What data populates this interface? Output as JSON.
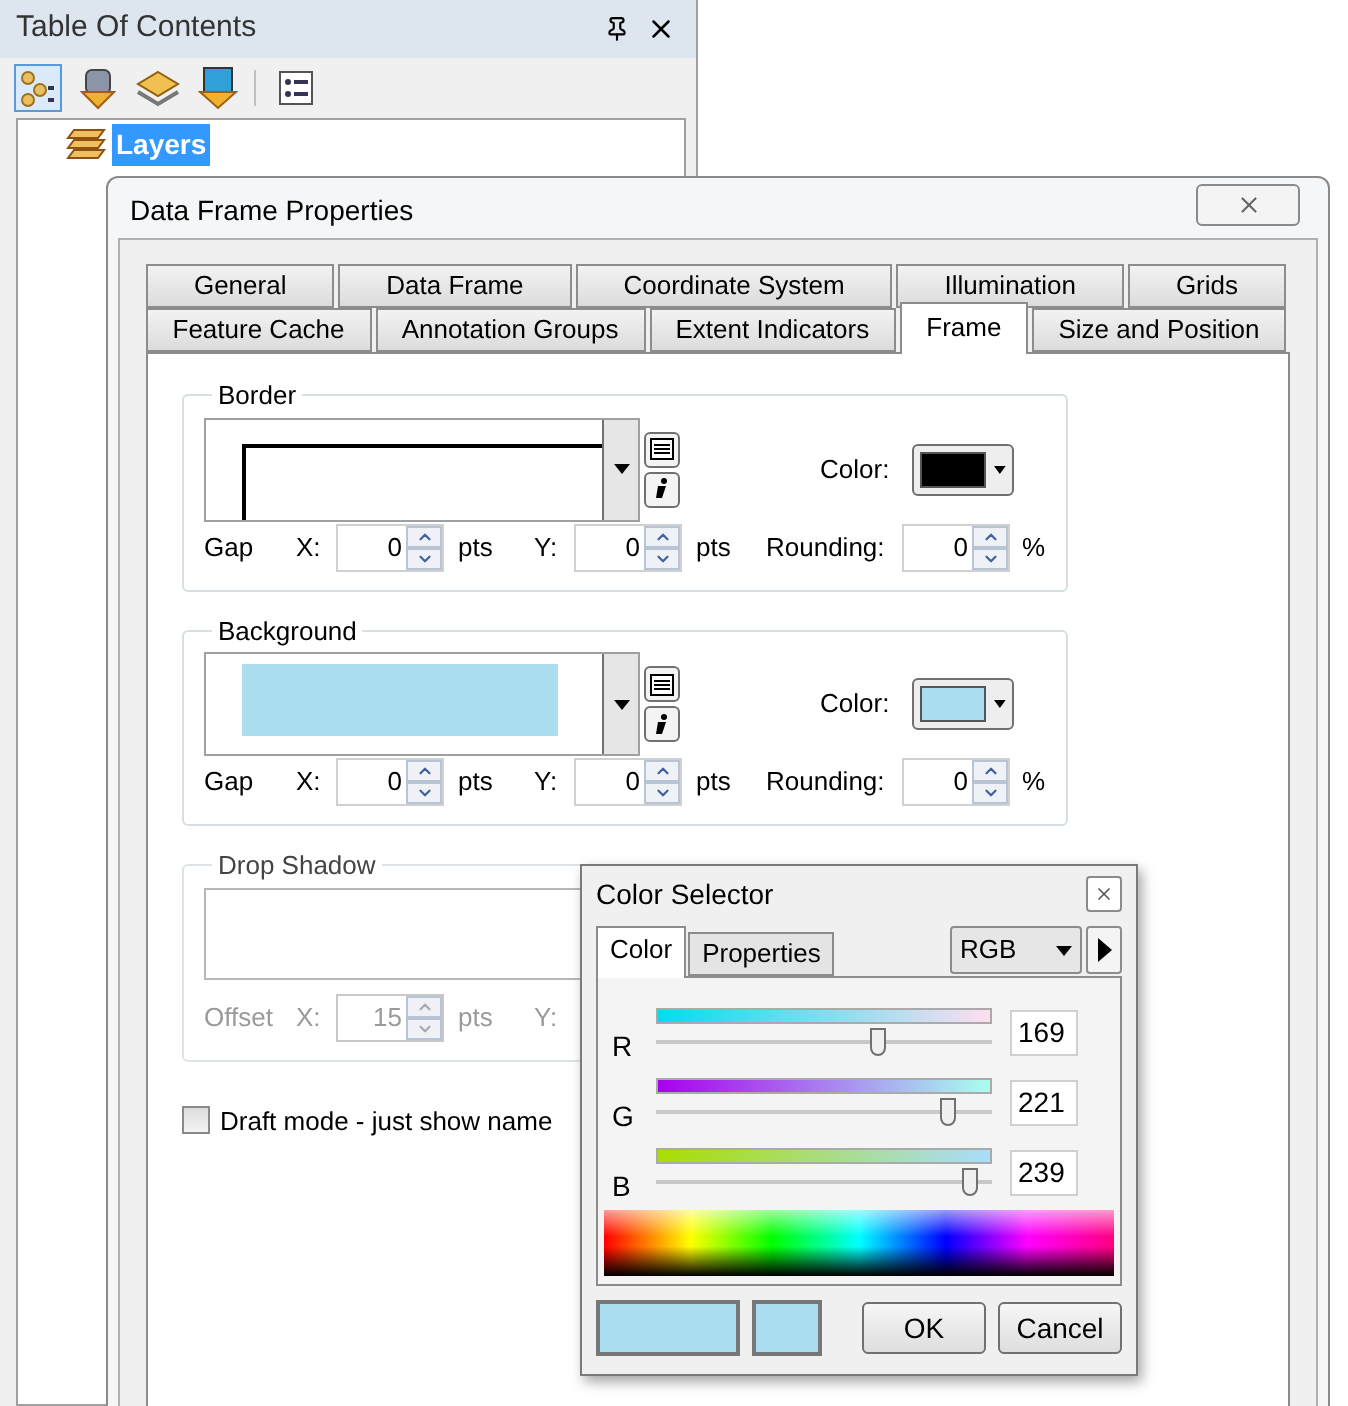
{
  "toc": {
    "title": "Table Of Contents",
    "toolbar": [
      {
        "kind": "drawing_order",
        "selected": true
      },
      {
        "kind": "source",
        "selected": false
      },
      {
        "kind": "visibility",
        "selected": false
      },
      {
        "kind": "selection",
        "selected": false
      },
      {
        "kind": "options",
        "selected": false
      }
    ],
    "tree": [
      {
        "label": "Layers",
        "selected": true
      }
    ]
  },
  "dialog": {
    "title": "Data Frame Properties",
    "tab_rows": [
      {
        "tabs": [
          {
            "label": "General",
            "selected": false
          },
          {
            "label": "Data Frame",
            "selected": false
          },
          {
            "label": "Coordinate System",
            "selected": false
          },
          {
            "label": "Illumination",
            "selected": false
          },
          {
            "label": "Grids",
            "selected": false
          }
        ]
      },
      {
        "tabs": [
          {
            "label": "Feature Cache",
            "selected": false
          },
          {
            "label": "Annotation Groups",
            "selected": false
          },
          {
            "label": "Extent Indicators",
            "selected": false
          },
          {
            "label": "Frame",
            "selected": true
          },
          {
            "label": "Size and Position",
            "selected": false
          }
        ]
      }
    ],
    "groups": [
      {
        "title": "Border",
        "kind": "line",
        "color_label": "Color:",
        "color": "#000000",
        "gap_label": "Gap",
        "x_label": "X:",
        "x_value": "0",
        "x_unit": "pts",
        "y_label": "Y:",
        "y_value": "0",
        "y_unit": "pts",
        "rounding_label": "Rounding:",
        "rounding_value": "0",
        "rounding_unit": "%"
      },
      {
        "title": "Background",
        "kind": "fill",
        "color_label": "Color:",
        "color": "#a9ddef",
        "gap_label": "Gap",
        "x_label": "X:",
        "x_value": "0",
        "x_unit": "pts",
        "y_label": "Y:",
        "y_value": "0",
        "y_unit": "pts",
        "rounding_label": "Rounding:",
        "rounding_value": "0",
        "rounding_unit": "%"
      }
    ],
    "drop_shadow": {
      "title": "Drop Shadow",
      "disabled": true,
      "offset_label": "Offset",
      "x_label": "X:",
      "x_value": "15",
      "x_unit": "pts",
      "y_label": "Y:"
    },
    "draft_mode": {
      "label": "Draft mode - just show name",
      "checked": false
    }
  },
  "color_selector": {
    "title": "Color Selector",
    "tabs": [
      {
        "label": "Color",
        "selected": true
      },
      {
        "label": "Properties",
        "selected": false
      }
    ],
    "model": "RGB",
    "sliders": [
      {
        "label": "R",
        "value": "169",
        "level": 0.663
      },
      {
        "label": "G",
        "value": "221",
        "level": 0.867
      },
      {
        "label": "B",
        "value": "239",
        "level": 0.937
      }
    ],
    "swatches": [
      {
        "color": "#a9ddef"
      },
      {
        "color": "#a9ddef"
      }
    ],
    "buttons": [
      "OK",
      "Cancel"
    ]
  }
}
